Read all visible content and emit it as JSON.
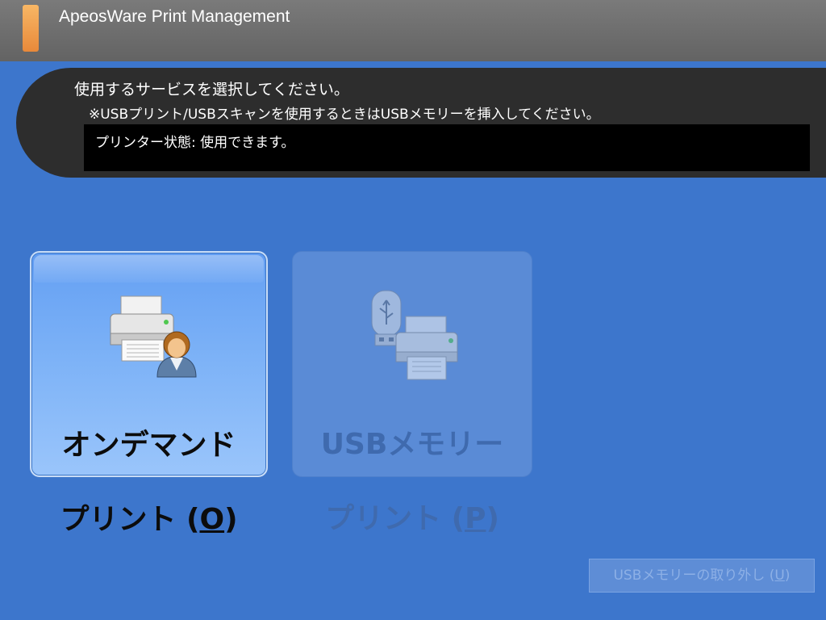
{
  "header": {
    "app_title": "ApeosWare Print Management"
  },
  "message": {
    "main": "使用するサービスを選択してください。",
    "sub": "※USBプリント/USBスキャンを使用するときはUSBメモリーを挿入してください。",
    "status": "プリンター状態: 使用できます。"
  },
  "services": [
    {
      "line1": "オンデマンド",
      "line2_prefix": "プリント (",
      "shortcut": "O",
      "line2_suffix": ")",
      "icon": "printer-user-icon",
      "enabled": true
    },
    {
      "line1": "USBメモリー",
      "line2_prefix": "プリント (",
      "shortcut": "P",
      "line2_suffix": ")",
      "icon": "usb-printer-icon",
      "enabled": false
    }
  ],
  "remove_usb": {
    "prefix": "USBメモリーの取り外し (",
    "shortcut": "U",
    "suffix": ")",
    "enabled": false
  },
  "colors": {
    "background": "#3d76cc",
    "titlebar": "#6b6b6b",
    "brand_accent": "#f0a050",
    "message_panel": "#2d2d2d"
  }
}
